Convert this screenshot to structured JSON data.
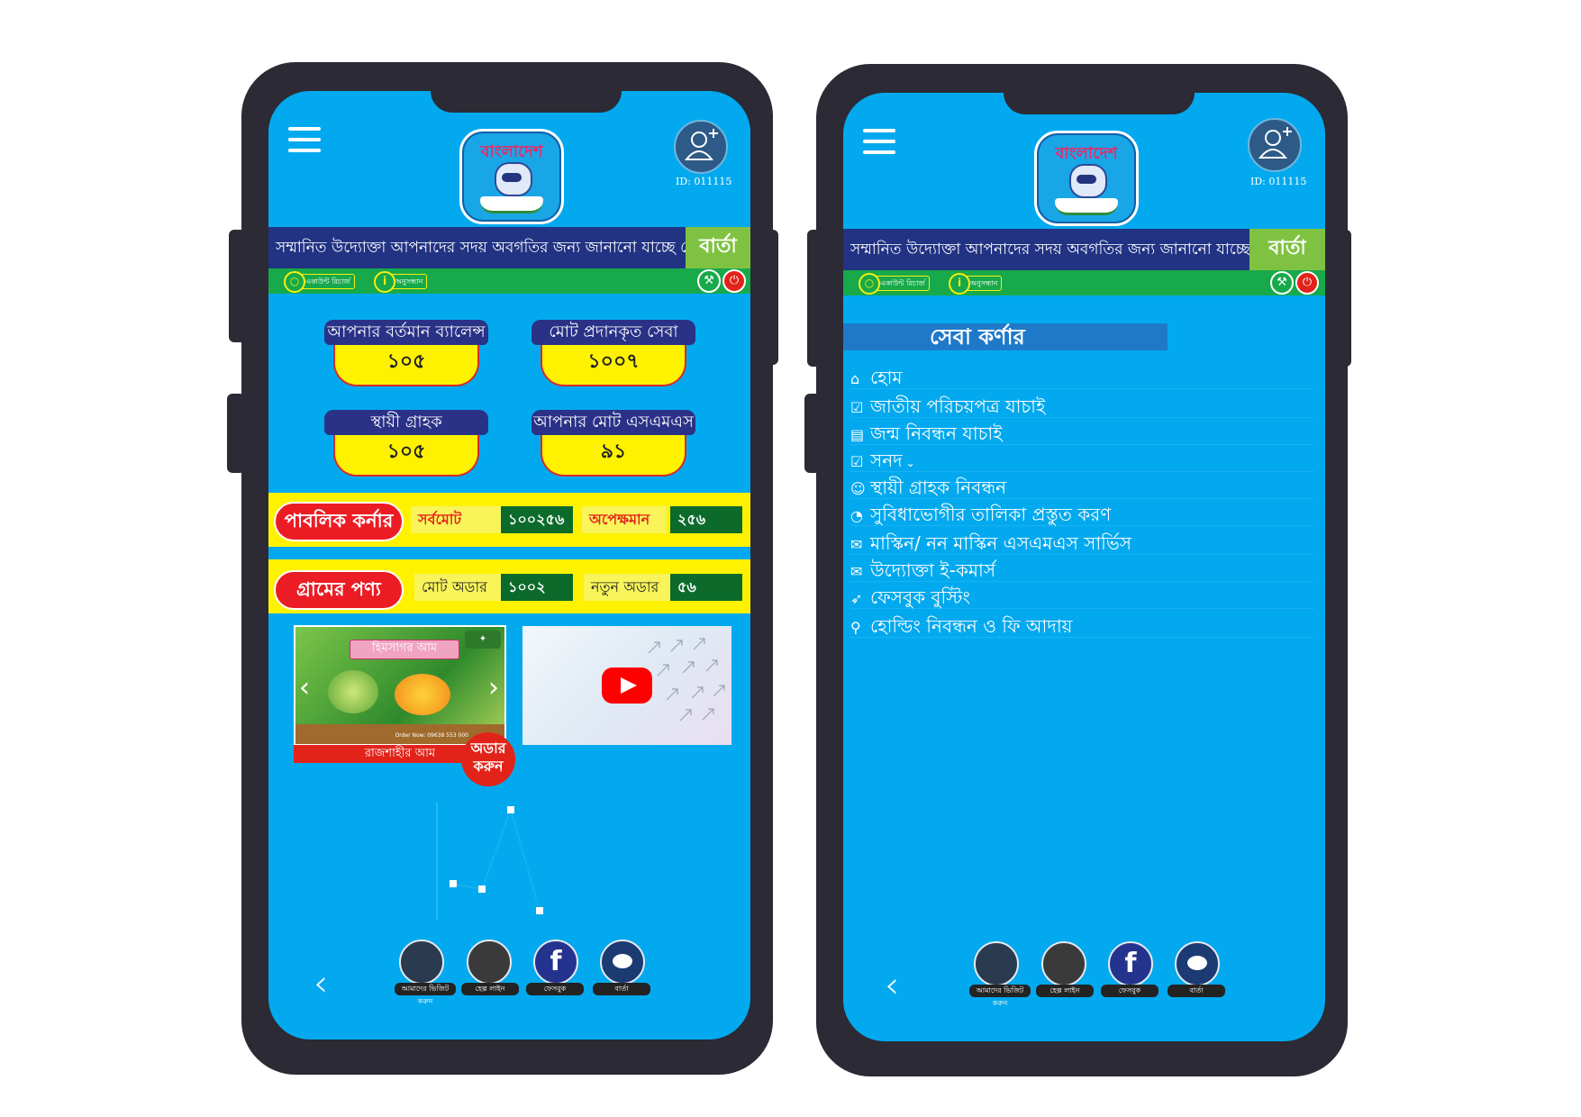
{
  "header": {
    "brand": "বাংলাদেশ",
    "user_id": "ID: 011115"
  },
  "notice": {
    "text": "সম্মানিত উদ্যোক্তা আপনাদের সদয় অবগতির জন্য জানানো যাচ্ছে যে,",
    "badge": "বার্তা"
  },
  "actionbar": {
    "chip1": "একাউন্ট রিচার্জ",
    "chip2": "অনুসন্ধান"
  },
  "stats": [
    {
      "label": "আপনার বর্তমান ব্যালেন্স",
      "value": "১০৫"
    },
    {
      "label": "মোট প্রদানকৃত সেবা",
      "value": "১০০৭"
    },
    {
      "label": "স্থায়ী গ্রাহক",
      "value": "১০৫"
    },
    {
      "label": "আপনার মোট এসএমএস",
      "value": "৯১"
    }
  ],
  "public_corner": {
    "title": "পাবলিক কর্নার",
    "total_label": "সর্বমোট",
    "total_value": "১০০২৫৬",
    "pending_label": "অপেক্ষমান",
    "pending_value": "২৫৬"
  },
  "village_products": {
    "title": "গ্রামের পণ্য",
    "orders_label": "মোট অডার",
    "orders_value": "১০০২",
    "new_label": "নতুন অডার",
    "new_value": "৫৬"
  },
  "promo": {
    "banner_title": "হিমসাগর আম",
    "order_no": "Order Now: 09638 553 000",
    "caption": "রাজশাহীর আম",
    "order_line1": "অডার",
    "order_line2": "করুন"
  },
  "footer": {
    "items": [
      {
        "label": "আমাদের ভিজিট করুন",
        "icon": "globe-icon"
      },
      {
        "label": "হেল্প লাইন",
        "icon": "headset-icon"
      },
      {
        "label": "ফেসবুক",
        "icon": "facebook-icon"
      },
      {
        "label": "বার্তা",
        "icon": "reddit-icon"
      }
    ]
  },
  "service_corner": {
    "title": "সেবা কর্ণার",
    "items": [
      {
        "label": "হোম",
        "icon": "home-icon"
      },
      {
        "label": "জাতীয় পরিচয়পত্র যাচাই",
        "icon": "id-check-icon"
      },
      {
        "label": "জন্ম নিবন্ধন যাচাই",
        "icon": "birth-reg-icon"
      },
      {
        "label": "সনদ",
        "icon": "certificate-icon"
      },
      {
        "label": "স্থায়ী গ্রাহক নিবন্ধন",
        "icon": "user-icon"
      },
      {
        "label": "সুবিধাভোগীর তালিকা প্রস্তুত করণ",
        "icon": "list-icon"
      },
      {
        "label": "মাস্কিন/ নন মাস্কিন এসএমএস সার্ভিস",
        "icon": "mail-icon"
      },
      {
        "label": "উদ্যোক্তা ই-কমার্স",
        "icon": "ecommerce-icon"
      },
      {
        "label": "ফেসবুক বুস্টিং",
        "icon": "rocket-icon"
      },
      {
        "label": "হোল্ডিং নিবন্ধন ও ফি আদায়",
        "icon": "search-icon"
      }
    ]
  }
}
